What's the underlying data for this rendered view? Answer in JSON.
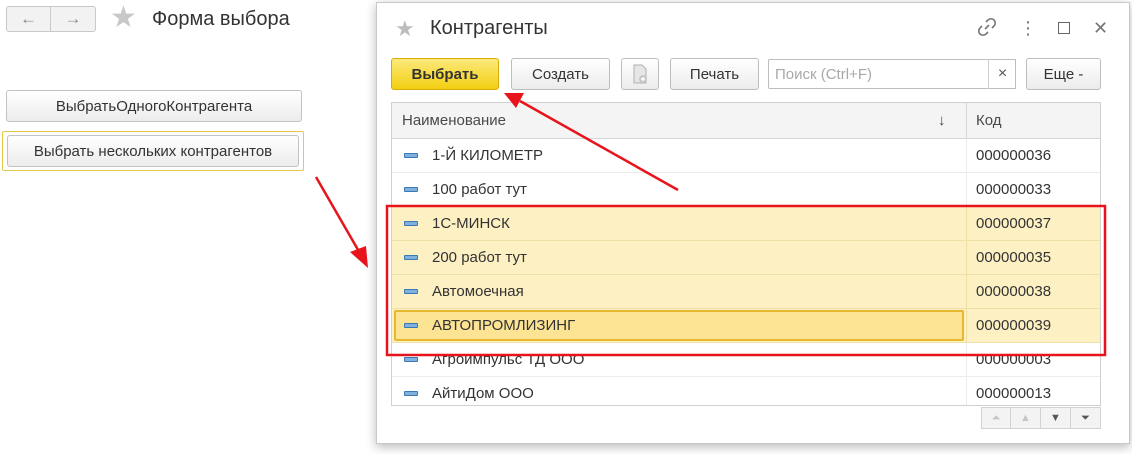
{
  "main_form": {
    "back_icon": "←",
    "forward_icon": "→",
    "favorite_icon": "★",
    "title": "Форма выбора",
    "btn_select_one": "ВыбратьОдногоКонтрагента",
    "btn_select_many": "Выбрать нескольких контрагентов"
  },
  "dialog": {
    "title": "Контрагенты",
    "link_icon": "🔗",
    "more_icon": "⋮",
    "maximize_icon": "☐",
    "close_icon": "✕",
    "toolbar": {
      "select_label": "Выбрать",
      "create_label": "Создать",
      "print_label": "Печать",
      "search_placeholder": "Поиск (Ctrl+F)",
      "search_clear": "×",
      "more_label": "Еще -"
    },
    "table": {
      "columns": [
        "Наименование",
        "Код"
      ],
      "sort_indicator": "↓",
      "rows": [
        {
          "name": "1-Й КИЛОМЕТР",
          "code": "000000036",
          "selected": false
        },
        {
          "name": "100 работ тут",
          "code": "000000033",
          "selected": false
        },
        {
          "name": "1С-МИНСК",
          "code": "000000037",
          "selected": true
        },
        {
          "name": "200 работ тут",
          "code": "000000035",
          "selected": true
        },
        {
          "name": "Автомоечная",
          "code": "000000038",
          "selected": true
        },
        {
          "name": "АВТОПРОМЛИЗИНГ",
          "code": "000000039",
          "selected": true
        },
        {
          "name": "Агроимпульс ТД ООО",
          "code": "000000003",
          "selected": false
        },
        {
          "name": "АйтиДом ООО",
          "code": "000000013",
          "selected": false
        }
      ]
    },
    "scroll_controls": [
      "⏶",
      "▲",
      "▼",
      "⏷"
    ]
  },
  "colors": {
    "accent_yellow": "#f3cf12",
    "selection_bg": "#fdf0c2",
    "annotation_red": "#e8141c"
  }
}
